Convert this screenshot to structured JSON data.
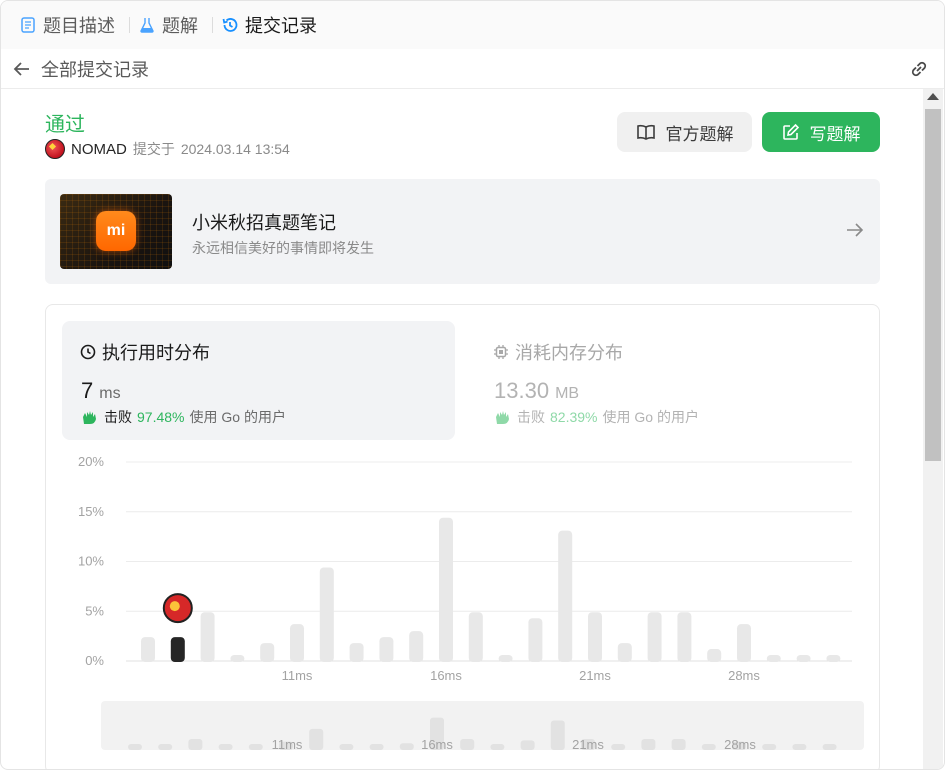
{
  "tabs": [
    {
      "label": "题目描述",
      "icon": "document-icon"
    },
    {
      "label": "题解",
      "icon": "flask-icon"
    },
    {
      "label": "提交记录",
      "icon": "history-icon",
      "active": true
    }
  ],
  "subbar": {
    "back_label": "全部提交记录"
  },
  "submission": {
    "status": "通过",
    "user": "NOMAD",
    "submitted_text": "提交于",
    "datetime": "2024.03.14 13:54"
  },
  "buttons": {
    "official": "官方题解",
    "write": "写题解"
  },
  "promo": {
    "logo_text": "mi",
    "title": "小米秋招真题笔记",
    "subtitle": "永远相信美好的事情即将发生"
  },
  "runtime": {
    "title": "执行用时分布",
    "value": "7",
    "unit": "ms",
    "beat_verb": "击败",
    "beat_pct": "97.48%",
    "beat_suffix": "使用 Go 的用户"
  },
  "memory": {
    "title": "消耗内存分布",
    "value": "13.30",
    "unit": "MB",
    "beat_verb": "击败",
    "beat_pct": "82.39%",
    "beat_suffix": "使用 Go 的用户"
  },
  "colors": {
    "accent_green": "#2db55d",
    "bar": "#e8e8e8",
    "highlight_bar": "#262626"
  },
  "chart_data": {
    "type": "bar",
    "title": "执行用时分布",
    "xlabel": "",
    "ylabel": "",
    "ylim": [
      0,
      20
    ],
    "y_ticks": [
      "0%",
      "5%",
      "15%",
      "10%",
      "20%"
    ],
    "y_tick_values": [
      0,
      5,
      15,
      10,
      20
    ],
    "x_tick_labels": [
      {
        "label": "11ms",
        "x": 11
      },
      {
        "label": "16ms",
        "x": 16
      },
      {
        "label": "21ms",
        "x": 21
      },
      {
        "label": "28ms",
        "x": 26
      }
    ],
    "x": [
      6,
      7,
      8,
      9,
      10,
      11,
      12,
      13,
      14,
      15,
      16,
      17,
      18,
      19,
      20,
      21,
      22,
      23,
      24,
      25,
      26,
      27,
      28,
      29
    ],
    "values": [
      2.4,
      2.4,
      4.9,
      0.6,
      1.8,
      3.7,
      9.4,
      1.8,
      2.4,
      3.0,
      14.4,
      4.9,
      0.6,
      4.3,
      13.1,
      4.9,
      1.8,
      4.9,
      4.9,
      1.2,
      3.7,
      0.6,
      0.6,
      0.6
    ],
    "highlight_x": 7,
    "grid": true,
    "overview_labels": [
      "11ms",
      "16ms",
      "21ms",
      "28ms"
    ]
  }
}
